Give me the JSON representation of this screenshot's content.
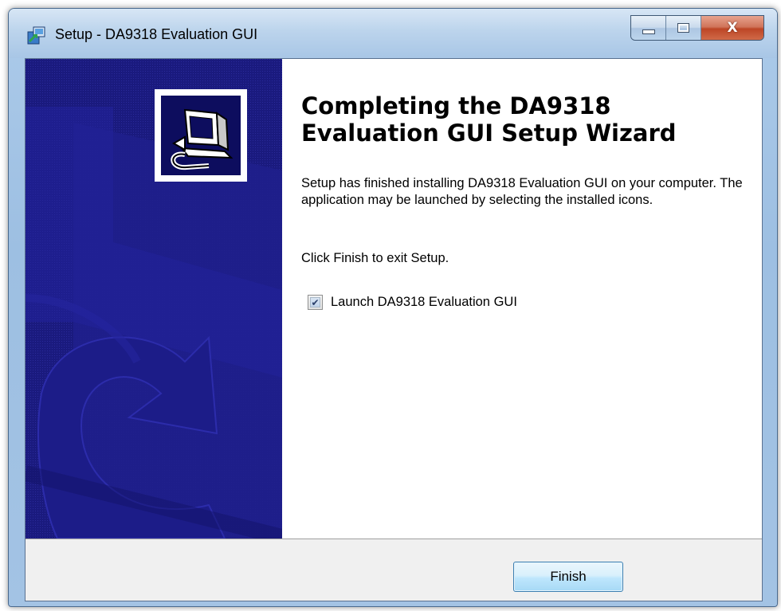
{
  "window": {
    "title": "Setup - DA9318 Evaluation GUI",
    "app_icon": "setup-installer-icon",
    "controls": {
      "minimize_icon": "minimize-icon",
      "maximize_icon": "maximize-icon",
      "close_glyph": "X"
    }
  },
  "side_panel": {
    "icon": "computer-install-icon"
  },
  "content": {
    "heading": "Completing the DA9318 Evaluation GUI Setup Wizard",
    "paragraph_1": "Setup has finished installing DA9318 Evaluation GUI on your computer. The application may be launched by selecting the installed icons.",
    "paragraph_2": "Click Finish to exit Setup.",
    "launch_checkbox": {
      "label": "Launch DA9318 Evaluation GUI",
      "checked": true,
      "mark": "✔"
    }
  },
  "footer": {
    "finish_label": "Finish"
  },
  "colors": {
    "side_panel": "#1a1a7e",
    "button_border": "#3c7fb1",
    "close_button": "#c7533a"
  }
}
